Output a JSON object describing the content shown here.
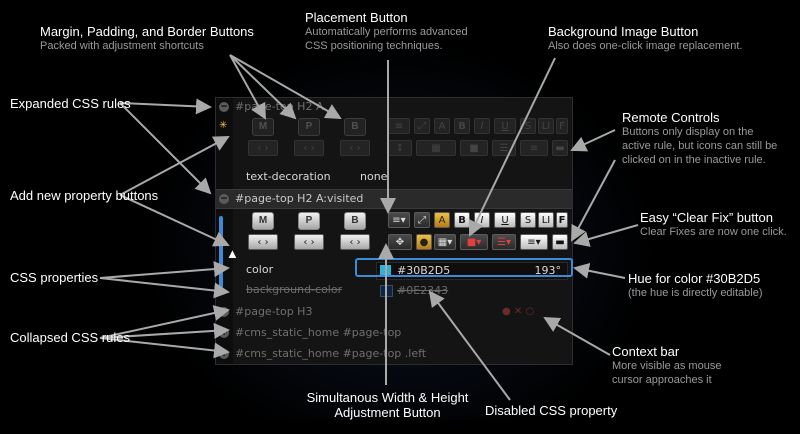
{
  "callouts": {
    "margin": {
      "title": "Margin, Padding, and Border Buttons",
      "sub": "Packed with adjustment shortcuts"
    },
    "placement": {
      "title": "Placement Button",
      "sub1": "Automatically performs advanced",
      "sub2": "CSS positioning techniques."
    },
    "bgimage": {
      "title": "Background Image Button",
      "sub": "Also does one-click image replacement."
    },
    "expanded": {
      "title": "Expanded CSS rules"
    },
    "remote": {
      "title": "Remote Controls",
      "sub1": "Buttons only display on the",
      "sub2": "active rule, but icons can still be",
      "sub3": "clicked on in the inactive rule."
    },
    "addprop": {
      "title": "Add new property buttons"
    },
    "clearfix": {
      "title": "Easy “Clear Fix” button",
      "sub": "Clear Fixes are now one click."
    },
    "cssprops": {
      "title": "CSS properties"
    },
    "hue": {
      "title": "Hue for color #30B2D5",
      "sub": "(the hue is directly editable)"
    },
    "collapsed": {
      "title": "Collapsed CSS rules"
    },
    "context": {
      "title": "Context bar",
      "sub1": "More visible as mouse",
      "sub2": "cursor approaches it"
    },
    "simultaneous": {
      "title1": "Simultanous Width & Height",
      "title2": "Adjustment Button"
    },
    "disabled": {
      "title": "Disabled CSS property"
    }
  },
  "panel": {
    "rules": [
      {
        "selector": "#page-top H2 A",
        "state": "expanded-inactive"
      },
      {
        "selector": "#page-top H2 A:visited",
        "state": "expanded-active"
      },
      {
        "selector": "#page-top H3",
        "state": "collapsed"
      },
      {
        "selector": "#cms_static_home #page-top",
        "state": "collapsed"
      },
      {
        "selector": "#cms_static_home #page-top .left",
        "state": "collapsed"
      }
    ],
    "rule1_props": [
      {
        "name": "text-decoration",
        "value": "none"
      }
    ],
    "rule2_props": [
      {
        "name": "color",
        "value": "#30B2D5",
        "hue": "193°",
        "swatch": "#30B2D5"
      },
      {
        "name": "background-color",
        "value": "#0E2343",
        "swatch": "#0E2343",
        "disabled": true
      }
    ],
    "toggle_expanded": "−",
    "toggle_collapsed": "+",
    "toolbar_labels": {
      "margin": "M",
      "padding": "P",
      "border": "B",
      "bold": "B",
      "italic": "I",
      "underline": "U",
      "strike": "S",
      "clear": "LI",
      "font": "F",
      "text": "A"
    }
  },
  "colors": {
    "accent": "#3d8bd8",
    "swatch_color": "#30B2D5",
    "swatch_bg": "#0E2343"
  }
}
